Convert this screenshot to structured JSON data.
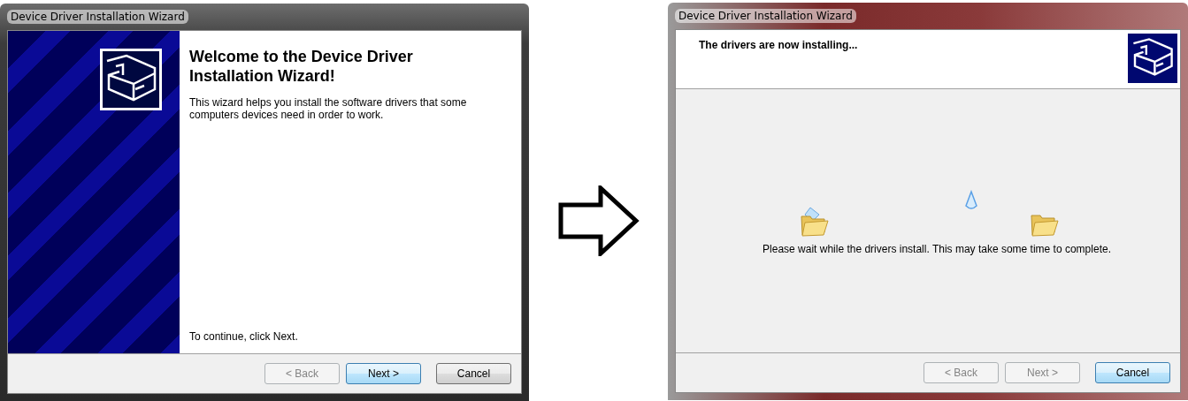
{
  "windows": [
    {
      "kind": "welcome",
      "title": "Device Driver Installation Wizard",
      "heading": "Welcome to the Device Driver Installation Wizard!",
      "body": "This wizard helps you install the software drivers that some computers devices need in order to work.",
      "footer_text": "To continue, click Next.",
      "buttons": [
        {
          "label": "< Back",
          "disabled": true,
          "default": false
        },
        {
          "label": "Next >",
          "disabled": false,
          "default": true
        },
        {
          "label": "Cancel",
          "disabled": false,
          "default": false
        }
      ]
    },
    {
      "kind": "progress",
      "title": "Device Driver Installation Wizard",
      "heading": "The drivers are now installing...",
      "body": "Please wait while the drivers install. This may take some time to complete.",
      "buttons": [
        {
          "label": "< Back",
          "disabled": true,
          "default": false
        },
        {
          "label": "Next >",
          "disabled": true,
          "default": false
        },
        {
          "label": "Cancel",
          "disabled": false,
          "default": true
        }
      ]
    }
  ]
}
